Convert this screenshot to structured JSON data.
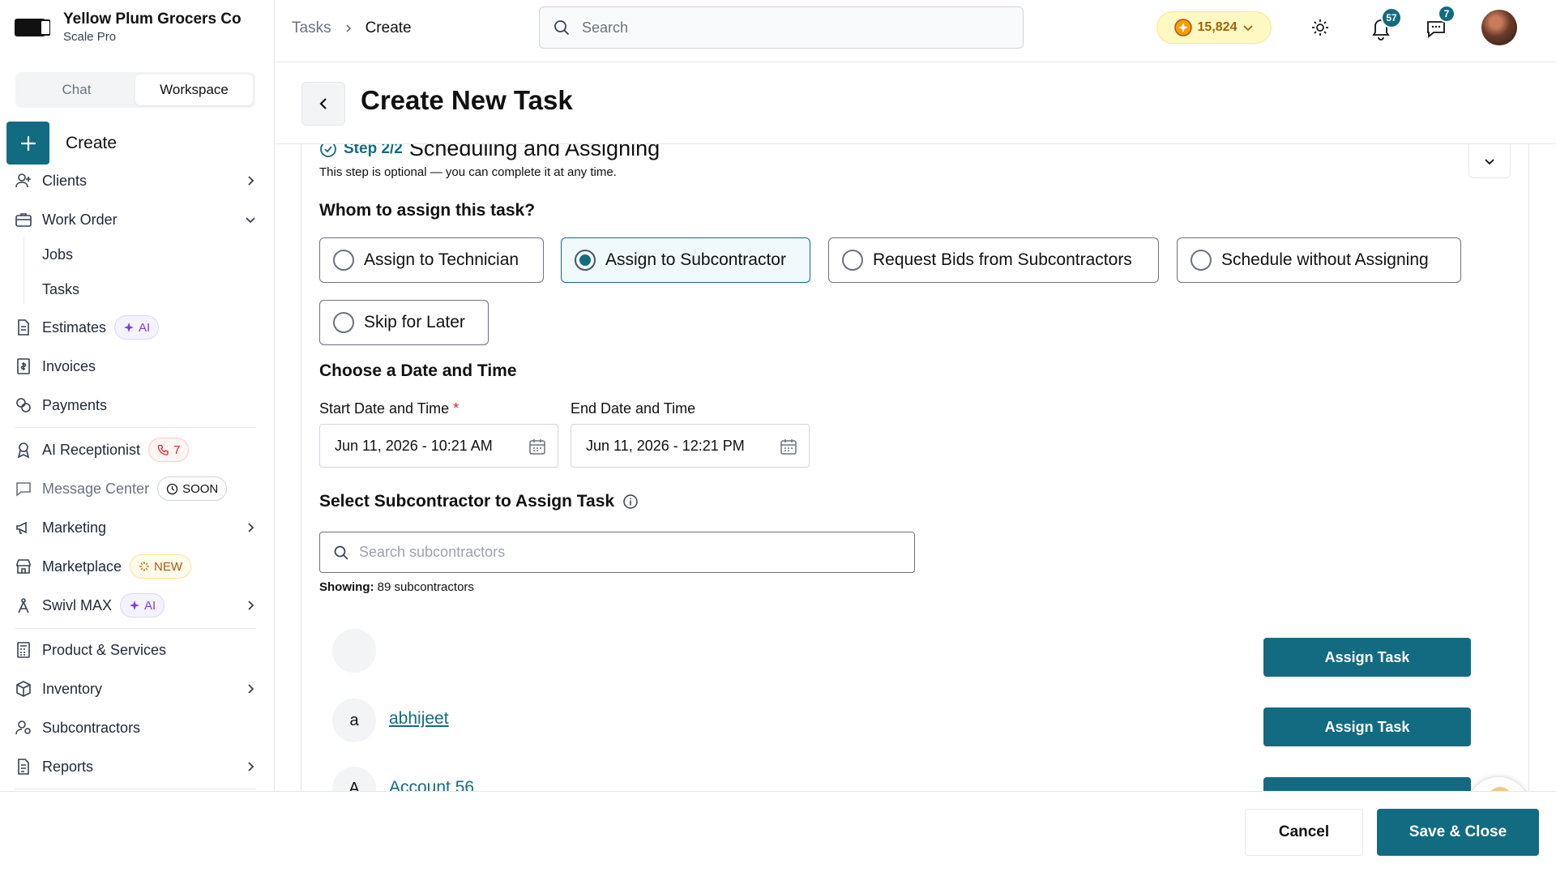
{
  "brand": {
    "name": "Yellow Plum Grocers Co",
    "plan": "Scale Pro"
  },
  "segments": {
    "chat": "Chat",
    "workspace": "Workspace",
    "active": "workspace"
  },
  "sidebar": {
    "create_label": "Create",
    "items": [
      {
        "label": "Clients"
      },
      {
        "label": "Work Order"
      },
      {
        "label": "Jobs"
      },
      {
        "label": "Tasks"
      },
      {
        "label": "Estimates",
        "badge": "AI"
      },
      {
        "label": "Invoices"
      },
      {
        "label": "Payments"
      },
      {
        "label": "AI Receptionist",
        "badge": "7"
      },
      {
        "label": "Message Center",
        "badge": "SOON"
      },
      {
        "label": "Marketing"
      },
      {
        "label": "Marketplace",
        "badge": "NEW"
      },
      {
        "label": "Swivl MAX",
        "badge": "AI"
      },
      {
        "label": "Product & Services"
      },
      {
        "label": "Inventory"
      },
      {
        "label": "Subcontractors"
      },
      {
        "label": "Reports"
      }
    ]
  },
  "topbar": {
    "breadcrumb": [
      "Tasks",
      "Create"
    ],
    "search_placeholder": "Search",
    "credits": "15,824",
    "notifications_count": "57",
    "messages_count": "7"
  },
  "page": {
    "title": "Create New Task"
  },
  "step": {
    "label": "Step 2/2",
    "title": "Scheduling and Assigning",
    "note": "This step is optional — you can complete it at any time."
  },
  "assign": {
    "heading": "Whom to assign this task?",
    "options": [
      {
        "label": "Assign to Technician",
        "selected": false
      },
      {
        "label": "Assign to Subcontractor",
        "selected": true
      },
      {
        "label": "Request Bids from Subcontractors",
        "selected": false
      },
      {
        "label": "Schedule without Assigning",
        "selected": false
      },
      {
        "label": "Skip for Later",
        "selected": false
      }
    ]
  },
  "schedule": {
    "heading": "Choose a Date and Time",
    "start_label": "Start Date and Time",
    "start_required_mark": "*",
    "start_value": "Jun 11, 2026 - 10:21 AM",
    "end_label": "End Date and Time",
    "end_value": "Jun 11, 2026 - 12:21 PM"
  },
  "subcontractors": {
    "heading": "Select Subcontractor to Assign Task",
    "search_placeholder": "Search subcontractors",
    "showing_label": "Showing:",
    "showing_value": "89 subcontractors",
    "rows": [
      {
        "initial": "",
        "name": "",
        "action": "Assign Task"
      },
      {
        "initial": "a",
        "name": "abhijeet",
        "action": "Assign Task"
      },
      {
        "initial": "A",
        "name": "Account 56",
        "action": ""
      }
    ]
  },
  "footer": {
    "cancel": "Cancel",
    "save": "Save & Close"
  },
  "colors": {
    "accent": "#136b82",
    "danger": "#dc2626",
    "ai": "#7c3aed",
    "new": "#b45309"
  }
}
